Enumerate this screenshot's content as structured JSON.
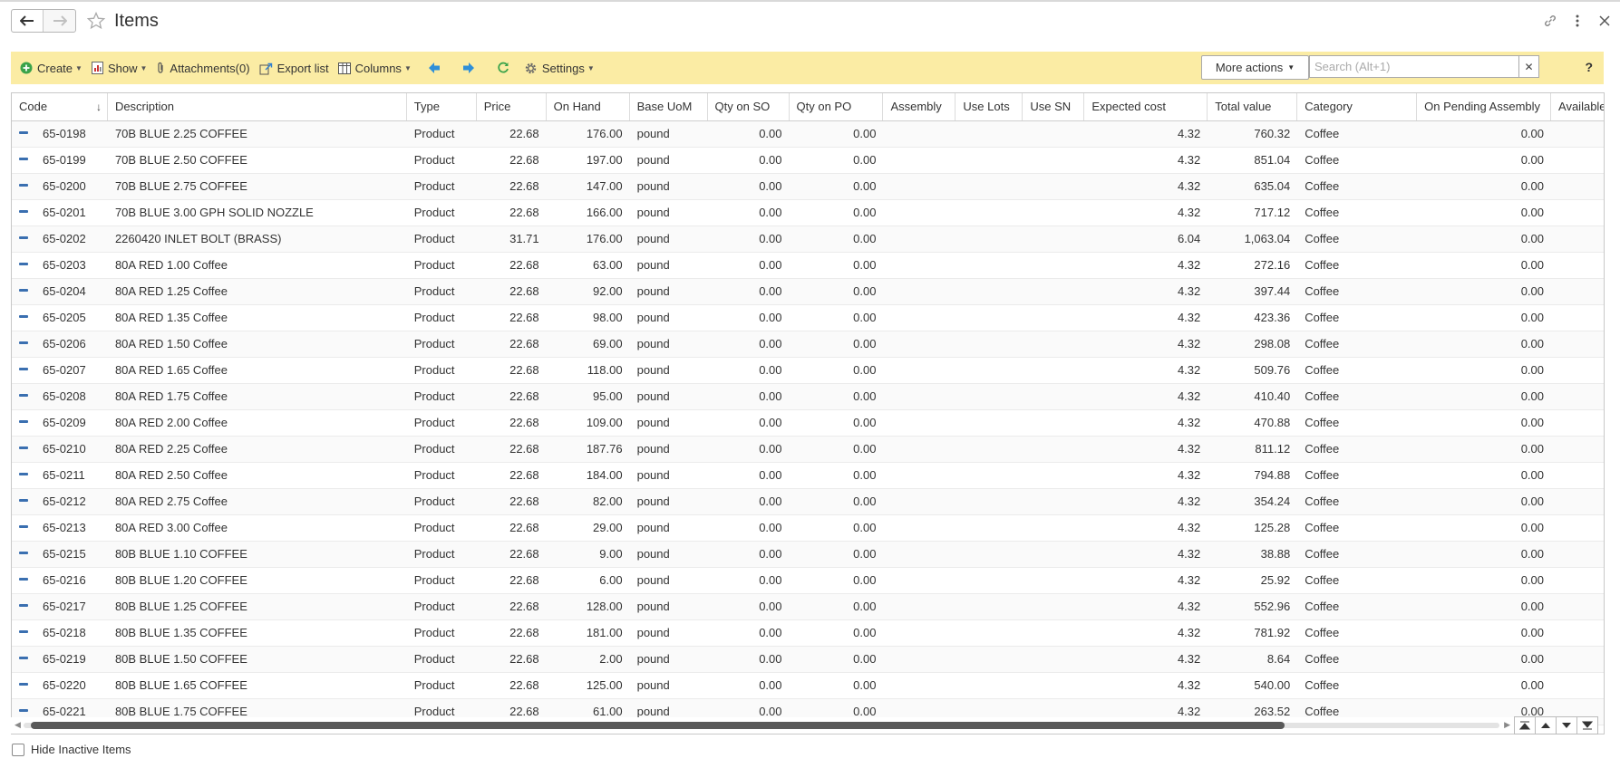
{
  "header": {
    "title": "Items",
    "icons": [
      "back-arrow-icon",
      "forward-arrow-icon",
      "star-icon",
      "link-icon",
      "more-vertical-icon",
      "close-icon"
    ]
  },
  "toolbar": {
    "create_label": "Create",
    "show_label": "Show",
    "attachments_label": "Attachments(0)",
    "export_label": "Export list",
    "columns_label": "Columns",
    "settings_label": "Settings",
    "more_actions_label": "More actions",
    "search_placeholder": "Search (Alt+1)",
    "search_value": "",
    "help_label": "?",
    "colors": {
      "toolbar_bg": "#fbeca4",
      "create_icon": "#3aa34a",
      "nav_arrows": "#2f8fd8",
      "refresh": "#3aa34a"
    }
  },
  "table": {
    "columns": [
      "Code",
      "Description",
      "Type",
      "Price",
      "On Hand",
      "Base UoM",
      "Qty on SO",
      "Qty on PO",
      "Assembly",
      "Use Lots",
      "Use SN",
      "Expected cost",
      "Total value",
      "Category",
      "On Pending Assembly",
      "Available"
    ],
    "sort_indicator": "↓",
    "rows": [
      [
        "65-0198",
        "70B BLUE 2.25 COFFEE",
        "Product",
        "22.68",
        "176.00",
        "pound",
        "0.00",
        "0.00",
        "",
        "",
        "",
        "4.32",
        "760.32",
        "Coffee",
        "0.00"
      ],
      [
        "65-0199",
        "70B BLUE 2.50 COFFEE",
        "Product",
        "22.68",
        "197.00",
        "pound",
        "0.00",
        "0.00",
        "",
        "",
        "",
        "4.32",
        "851.04",
        "Coffee",
        "0.00"
      ],
      [
        "65-0200",
        "70B BLUE 2.75 COFFEE",
        "Product",
        "22.68",
        "147.00",
        "pound",
        "0.00",
        "0.00",
        "",
        "",
        "",
        "4.32",
        "635.04",
        "Coffee",
        "0.00"
      ],
      [
        "65-0201",
        "70B BLUE 3.00 GPH SOLID NOZZLE",
        "Product",
        "22.68",
        "166.00",
        "pound",
        "0.00",
        "0.00",
        "",
        "",
        "",
        "4.32",
        "717.12",
        "Coffee",
        "0.00"
      ],
      [
        "65-0202",
        "2260420 INLET BOLT (BRASS)",
        "Product",
        "31.71",
        "176.00",
        "pound",
        "0.00",
        "0.00",
        "",
        "",
        "",
        "6.04",
        "1,063.04",
        "Coffee",
        "0.00"
      ],
      [
        "65-0203",
        "80A RED 1.00 Coffee",
        "Product",
        "22.68",
        "63.00",
        "pound",
        "0.00",
        "0.00",
        "",
        "",
        "",
        "4.32",
        "272.16",
        "Coffee",
        "0.00"
      ],
      [
        "65-0204",
        "80A RED 1.25 Coffee",
        "Product",
        "22.68",
        "92.00",
        "pound",
        "0.00",
        "0.00",
        "",
        "",
        "",
        "4.32",
        "397.44",
        "Coffee",
        "0.00"
      ],
      [
        "65-0205",
        "80A RED 1.35 Coffee",
        "Product",
        "22.68",
        "98.00",
        "pound",
        "0.00",
        "0.00",
        "",
        "",
        "",
        "4.32",
        "423.36",
        "Coffee",
        "0.00"
      ],
      [
        "65-0206",
        "80A RED 1.50 Coffee",
        "Product",
        "22.68",
        "69.00",
        "pound",
        "0.00",
        "0.00",
        "",
        "",
        "",
        "4.32",
        "298.08",
        "Coffee",
        "0.00"
      ],
      [
        "65-0207",
        "80A RED 1.65 Coffee",
        "Product",
        "22.68",
        "118.00",
        "pound",
        "0.00",
        "0.00",
        "",
        "",
        "",
        "4.32",
        "509.76",
        "Coffee",
        "0.00"
      ],
      [
        "65-0208",
        "80A RED 1.75 Coffee",
        "Product",
        "22.68",
        "95.00",
        "pound",
        "0.00",
        "0.00",
        "",
        "",
        "",
        "4.32",
        "410.40",
        "Coffee",
        "0.00"
      ],
      [
        "65-0209",
        "80A RED 2.00 Coffee",
        "Product",
        "22.68",
        "109.00",
        "pound",
        "0.00",
        "0.00",
        "",
        "",
        "",
        "4.32",
        "470.88",
        "Coffee",
        "0.00"
      ],
      [
        "65-0210",
        "80A RED 2.25 Coffee",
        "Product",
        "22.68",
        "187.76",
        "pound",
        "0.00",
        "0.00",
        "",
        "",
        "",
        "4.32",
        "811.12",
        "Coffee",
        "0.00"
      ],
      [
        "65-0211",
        "80A RED 2.50 Coffee",
        "Product",
        "22.68",
        "184.00",
        "pound",
        "0.00",
        "0.00",
        "",
        "",
        "",
        "4.32",
        "794.88",
        "Coffee",
        "0.00"
      ],
      [
        "65-0212",
        "80A RED 2.75 Coffee",
        "Product",
        "22.68",
        "82.00",
        "pound",
        "0.00",
        "0.00",
        "",
        "",
        "",
        "4.32",
        "354.24",
        "Coffee",
        "0.00"
      ],
      [
        "65-0213",
        "80A RED 3.00 Coffee",
        "Product",
        "22.68",
        "29.00",
        "pound",
        "0.00",
        "0.00",
        "",
        "",
        "",
        "4.32",
        "125.28",
        "Coffee",
        "0.00"
      ],
      [
        "65-0215",
        "80B BLUE 1.10 COFFEE",
        "Product",
        "22.68",
        "9.00",
        "pound",
        "0.00",
        "0.00",
        "",
        "",
        "",
        "4.32",
        "38.88",
        "Coffee",
        "0.00"
      ],
      [
        "65-0216",
        "80B BLUE 1.20 COFFEE",
        "Product",
        "22.68",
        "6.00",
        "pound",
        "0.00",
        "0.00",
        "",
        "",
        "",
        "4.32",
        "25.92",
        "Coffee",
        "0.00"
      ],
      [
        "65-0217",
        "80B BLUE 1.25 COFFEE",
        "Product",
        "22.68",
        "128.00",
        "pound",
        "0.00",
        "0.00",
        "",
        "",
        "",
        "4.32",
        "552.96",
        "Coffee",
        "0.00"
      ],
      [
        "65-0218",
        "80B BLUE 1.35 COFFEE",
        "Product",
        "22.68",
        "181.00",
        "pound",
        "0.00",
        "0.00",
        "",
        "",
        "",
        "4.32",
        "781.92",
        "Coffee",
        "0.00"
      ],
      [
        "65-0219",
        "80B BLUE 1.50 COFFEE",
        "Product",
        "22.68",
        "2.00",
        "pound",
        "0.00",
        "0.00",
        "",
        "",
        "",
        "4.32",
        "8.64",
        "Coffee",
        "0.00"
      ],
      [
        "65-0220",
        "80B BLUE 1.65 COFFEE",
        "Product",
        "22.68",
        "125.00",
        "pound",
        "0.00",
        "0.00",
        "",
        "",
        "",
        "4.32",
        "540.00",
        "Coffee",
        "0.00"
      ],
      [
        "65-0221",
        "80B BLUE 1.75 COFFEE",
        "Product",
        "22.68",
        "61.00",
        "pound",
        "0.00",
        "0.00",
        "",
        "",
        "",
        "4.32",
        "263.52",
        "Coffee",
        "0.00"
      ]
    ]
  },
  "footer": {
    "hide_inactive_label": "Hide Inactive Items",
    "hide_inactive_checked": false
  }
}
